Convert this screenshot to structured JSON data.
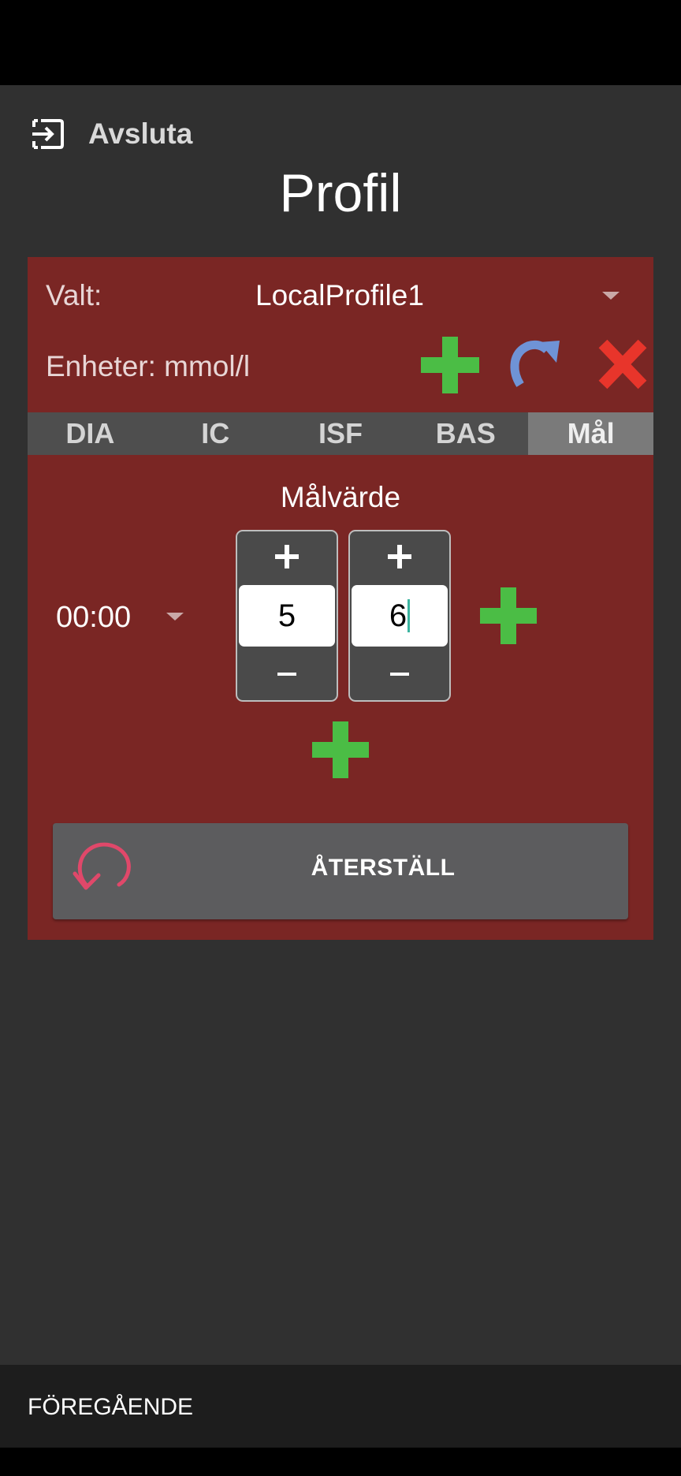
{
  "header": {
    "exit_label": "Avsluta",
    "title": "Profil"
  },
  "profile": {
    "selected_label": "Valt:",
    "selected_value": "LocalProfile1",
    "units_label": "Enheter: mmol/l"
  },
  "tabs": [
    {
      "label": "DIA",
      "active": false
    },
    {
      "label": "IC",
      "active": false
    },
    {
      "label": "ISF",
      "active": false
    },
    {
      "label": "BAS",
      "active": false
    },
    {
      "label": "Mål",
      "active": true
    }
  ],
  "target": {
    "title": "Målvärde",
    "time": "00:00",
    "low_value": "5",
    "high_value": "6"
  },
  "reset_label": "ÅTERSTÄLL",
  "footer": {
    "previous_label": "FÖREGÅENDE"
  },
  "colors": {
    "card_bg": "#7a2624",
    "add_green": "#4bbd45",
    "clone_blue": "#6f93d6",
    "delete_red": "#e8352b",
    "reset_icon": "#e0486a"
  },
  "icons": [
    "exit-icon",
    "add-profile-icon",
    "clone-profile-icon",
    "delete-profile-icon",
    "reset-icon"
  ]
}
